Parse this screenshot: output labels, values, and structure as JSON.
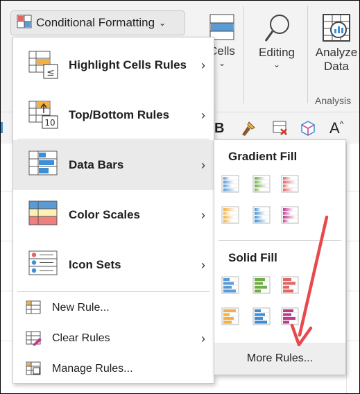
{
  "ribbon": {
    "conditional_formatting_label": "Conditional Formatting",
    "cells_label": "Cells",
    "editing_label": "Editing",
    "analyze_label_line1": "Analyze",
    "analyze_label_line2": "Data",
    "analysis_group_label": "Analysis",
    "bold_glyph": "B",
    "font_size_glyph": "A"
  },
  "menu": {
    "items": [
      {
        "label": "Highlight Cells Rules",
        "icon": "highlight-cells-rules-icon"
      },
      {
        "label": "Top/Bottom Rules",
        "icon": "top-bottom-rules-icon"
      },
      {
        "label": "Data Bars",
        "icon": "data-bars-icon"
      },
      {
        "label": "Color Scales",
        "icon": "color-scales-icon"
      },
      {
        "label": "Icon Sets",
        "icon": "icon-sets-icon"
      }
    ],
    "actions": [
      {
        "label": "New Rule...",
        "icon": "new-rule-icon"
      },
      {
        "label": "Clear Rules",
        "icon": "clear-rules-icon"
      },
      {
        "label": "Manage Rules...",
        "icon": "manage-rules-icon"
      }
    ]
  },
  "submenu": {
    "gradient_header": "Gradient Fill",
    "solid_header": "Solid Fill",
    "more_rules": "More Rules...",
    "bar_colors": [
      "#5b9bd5",
      "#70ad47",
      "#e06666",
      "#f4b042",
      "#3b8ed8",
      "#c0398f"
    ]
  },
  "colors": {
    "accent_arrow": "#e8494d",
    "selected_bg": "#eaeaea"
  }
}
